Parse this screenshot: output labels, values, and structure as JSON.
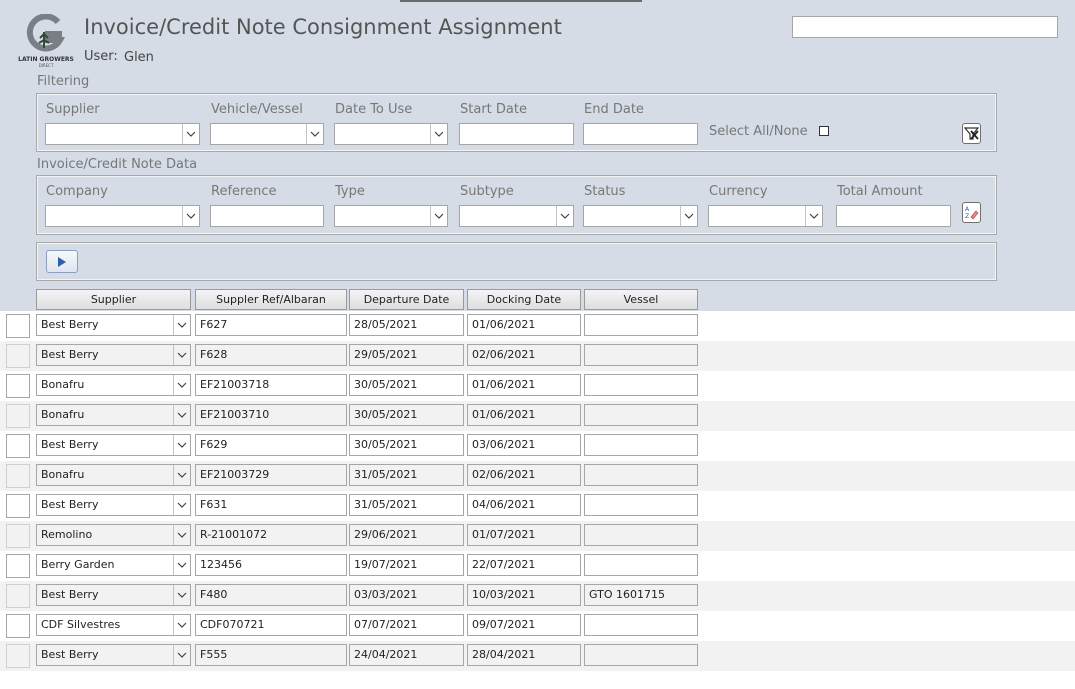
{
  "app": {
    "title": "Invoice/Credit Note Consignment Assignment",
    "user_label": "User:",
    "user_name": "Glen",
    "logo_text": "LATIN GROWERS",
    "logo_subtext": "DIRECT"
  },
  "search": {
    "value": ""
  },
  "filtering": {
    "section_label": "Filtering",
    "supplier_label": "Supplier",
    "vehicle_label": "Vehicle/Vessel",
    "date_to_use_label": "Date To Use",
    "start_date_label": "Start Date",
    "end_date_label": "End Date",
    "select_all_label": "Select All/None",
    "clear_filter_icon": "clear-filter-icon"
  },
  "invoice_data": {
    "section_label": "Invoice/Credit Note Data",
    "company_label": "Company",
    "reference_label": "Reference",
    "type_label": "Type",
    "subtype_label": "Subtype",
    "status_label": "Status",
    "currency_label": "Currency",
    "total_amount_label": "Total Amount",
    "clear_sort_icon": "sort-clear-icon"
  },
  "run_button_icon": "play-icon",
  "table": {
    "headers": {
      "supplier": "Supplier",
      "ref": "Suppler Ref/Albaran",
      "departure": "Departure Date",
      "docking": "Docking Date",
      "vessel": "Vessel"
    },
    "rows": [
      {
        "supplier": "Best Berry",
        "ref": "F627",
        "departure": "28/05/2021",
        "docking": "01/06/2021",
        "vessel": ""
      },
      {
        "supplier": "Best Berry",
        "ref": "F628",
        "departure": "29/05/2021",
        "docking": "02/06/2021",
        "vessel": ""
      },
      {
        "supplier": "Bonafru",
        "ref": "EF21003718",
        "departure": "30/05/2021",
        "docking": "01/06/2021",
        "vessel": ""
      },
      {
        "supplier": "Bonafru",
        "ref": "EF21003710",
        "departure": "30/05/2021",
        "docking": "01/06/2021",
        "vessel": ""
      },
      {
        "supplier": "Best Berry",
        "ref": "F629",
        "departure": "30/05/2021",
        "docking": "03/06/2021",
        "vessel": ""
      },
      {
        "supplier": "Bonafru",
        "ref": "EF21003729",
        "departure": "31/05/2021",
        "docking": "02/06/2021",
        "vessel": ""
      },
      {
        "supplier": "Best Berry",
        "ref": "F631",
        "departure": "31/05/2021",
        "docking": "04/06/2021",
        "vessel": ""
      },
      {
        "supplier": "Remolino",
        "ref": "R-21001072",
        "departure": "29/06/2021",
        "docking": "01/07/2021",
        "vessel": ""
      },
      {
        "supplier": "Berry Garden",
        "ref": "123456",
        "departure": "19/07/2021",
        "docking": "22/07/2021",
        "vessel": ""
      },
      {
        "supplier": "Best Berry",
        "ref": "F480",
        "departure": "03/03/2021",
        "docking": "10/03/2021",
        "vessel": "GTO 1601715"
      },
      {
        "supplier": "CDF Silvestres",
        "ref": "CDF070721",
        "departure": "07/07/2021",
        "docking": "09/07/2021",
        "vessel": ""
      },
      {
        "supplier": "Best Berry",
        "ref": "F555",
        "departure": "24/04/2021",
        "docking": "28/04/2021",
        "vessel": ""
      }
    ]
  }
}
